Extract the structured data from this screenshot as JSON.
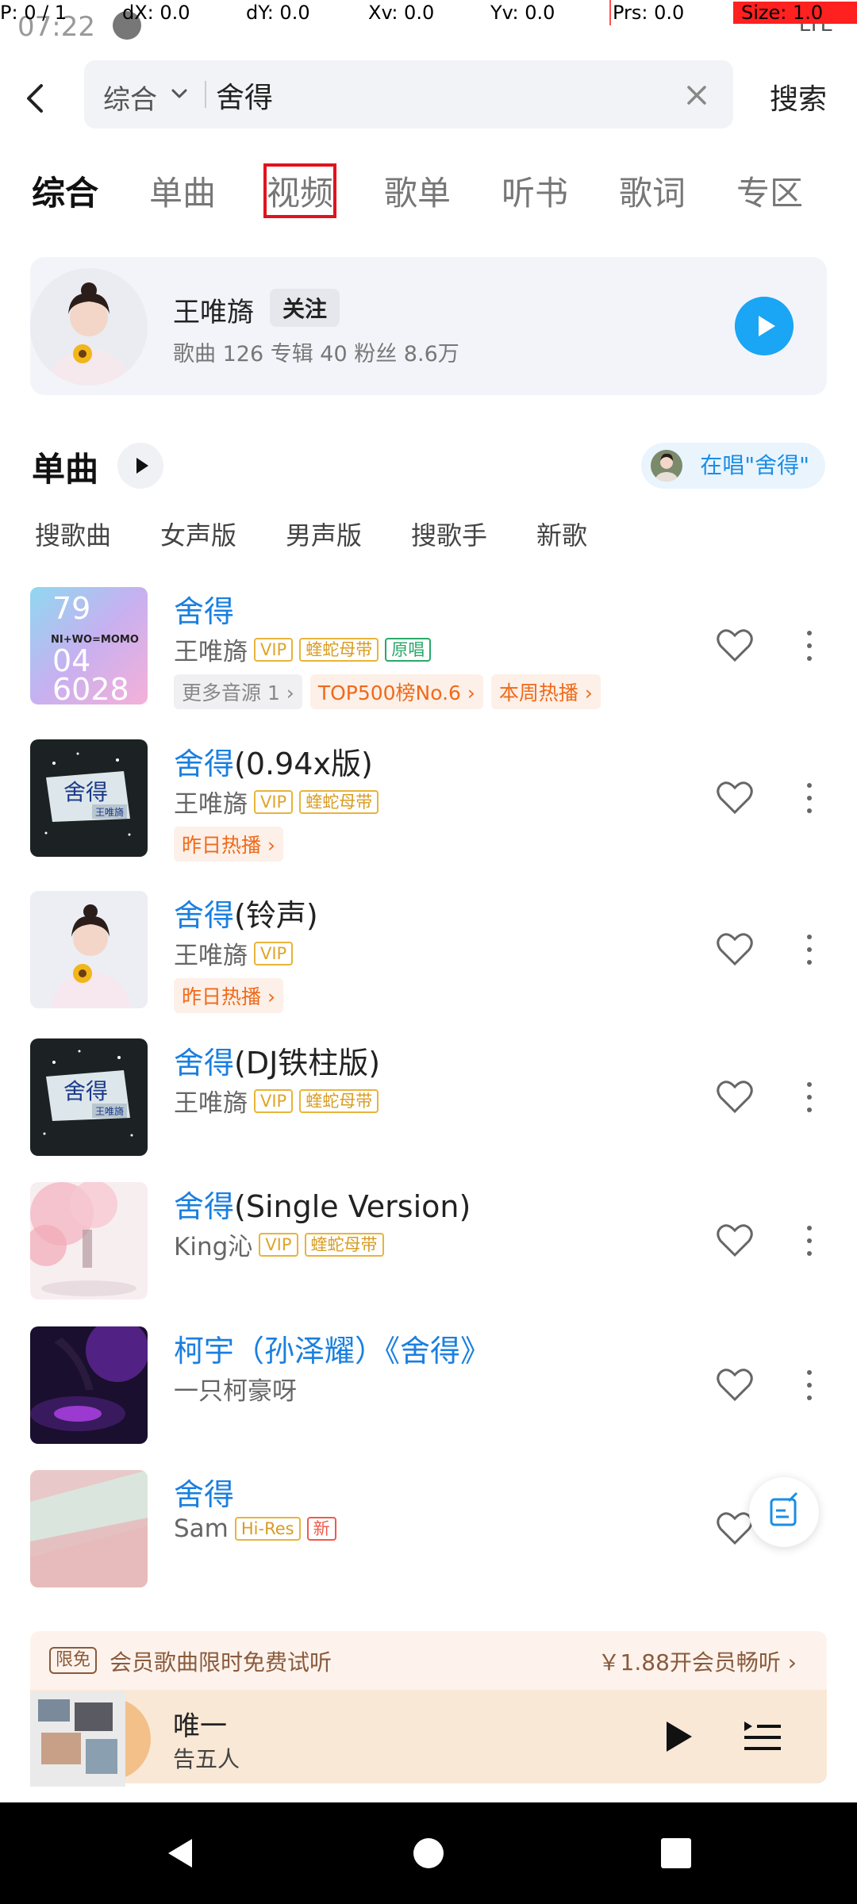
{
  "debug": {
    "p": "P: 0 / 1",
    "dx": "dX: 0.0",
    "dy": "dY: 0.0",
    "xv": "Xv: 0.0",
    "yv": "Yv: 0.0",
    "prs": "Prs: 0.0",
    "size": "Size: 1.0"
  },
  "status": {
    "time": "07:22",
    "network": "LTE"
  },
  "search": {
    "scope": "综合",
    "query": "舍得",
    "submit_label": "搜索"
  },
  "tabs": [
    {
      "label": "综合",
      "active": true
    },
    {
      "label": "单曲"
    },
    {
      "label": "视频"
    },
    {
      "label": "歌单"
    },
    {
      "label": "听书"
    },
    {
      "label": "歌词"
    },
    {
      "label": "专区"
    }
  ],
  "artist": {
    "name": "王唯旖",
    "follow_label": "关注",
    "stats": "歌曲 126   专辑 40   粉丝 8.6万"
  },
  "songs_section": {
    "title": "单曲",
    "singing_label": "在唱\"舍得\"",
    "filters": [
      "搜歌曲",
      "女声版",
      "男声版",
      "搜歌手",
      "新歌"
    ]
  },
  "songs": [
    {
      "title": "舍得",
      "suffix": "",
      "artist": "王唯旖",
      "tags": [
        "VIP",
        "蝰蛇母带",
        "原唱"
      ],
      "extras": [
        {
          "label": "更多音源 1 ›",
          "style": "grey"
        },
        {
          "label": "TOP500榜No.6 ›",
          "style": "orange"
        },
        {
          "label": "本周热播 ›",
          "style": "orange"
        }
      ]
    },
    {
      "title": "舍得",
      "suffix": "(0.94x版)",
      "artist": "王唯旖",
      "tags": [
        "VIP",
        "蝰蛇母带"
      ],
      "extras": [
        {
          "label": "昨日热播 ›",
          "style": "orange"
        }
      ]
    },
    {
      "title": "舍得",
      "suffix": "(铃声)",
      "artist": "王唯旖",
      "tags": [
        "VIP"
      ],
      "extras": [
        {
          "label": "昨日热播 ›",
          "style": "orange"
        }
      ]
    },
    {
      "title": "舍得",
      "suffix": "(DJ铁柱版)",
      "artist": "王唯旖",
      "tags": [
        "VIP",
        "蝰蛇母带"
      ],
      "extras": []
    },
    {
      "title": "舍得",
      "suffix": "(Single Version)",
      "artist": "King沁",
      "tags": [
        "VIP",
        "蝰蛇母带"
      ],
      "extras": []
    },
    {
      "title": "柯宇（孙泽耀）《舍得》",
      "suffix": "",
      "artist": "一只柯豪呀",
      "tags": [],
      "extras": []
    },
    {
      "title": "舍得",
      "suffix": "",
      "artist": "Sam",
      "tags": [
        "Hi-Res",
        "新"
      ],
      "extras": []
    }
  ],
  "cover1_text": {
    "a": "79",
    "b": "NI+WO=MOMO",
    "c": "04",
    "d": "6028"
  },
  "cover_text": {
    "main": "舍得",
    "sub": "王唯旖"
  },
  "vip": {
    "badge": "限免",
    "text": "会员歌曲限时免费试听",
    "cta": "￥1.88开会员畅听 ›"
  },
  "player": {
    "title": "唯一",
    "artist": "告五人"
  }
}
